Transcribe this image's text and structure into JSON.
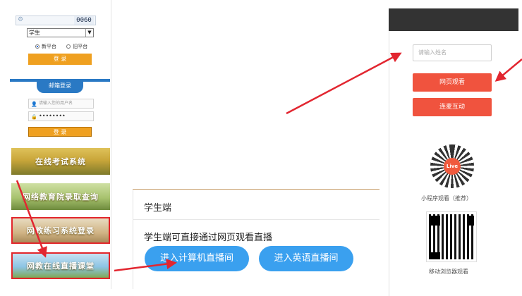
{
  "left": {
    "captcha_code": "0060",
    "role_select": "学生",
    "radio": {
      "new": "新平台",
      "old": "旧平台"
    },
    "login_button": "登 录",
    "mail_tab": "邮箱登录",
    "user_placeholder": "请输入您的用户名",
    "password_mask": "••••••••",
    "login_button_2": "登 录",
    "banners": [
      "在线考试系统",
      "网络教育院录取查询",
      "网教练习系统登录",
      "网教在线直播课堂"
    ]
  },
  "middle": {
    "section_title": "学生端",
    "description": "学生端可直接通过网页观看直播",
    "buttons": {
      "computer": "进入计算机直播间",
      "english": "进入英语直播间"
    }
  },
  "right": {
    "name_placeholder": "请输入姓名",
    "web_watch": "网页观看",
    "connect_mic": "连麦互动",
    "miniprogram_caption": "小程序观看（推荐）",
    "mobile_caption": "移动浏览器观看",
    "logo_text": "Live"
  },
  "colors": {
    "arrow": "#e22630",
    "pill": "#3aa0ef",
    "red_button": "#f0533e",
    "orange": "#efa020"
  }
}
